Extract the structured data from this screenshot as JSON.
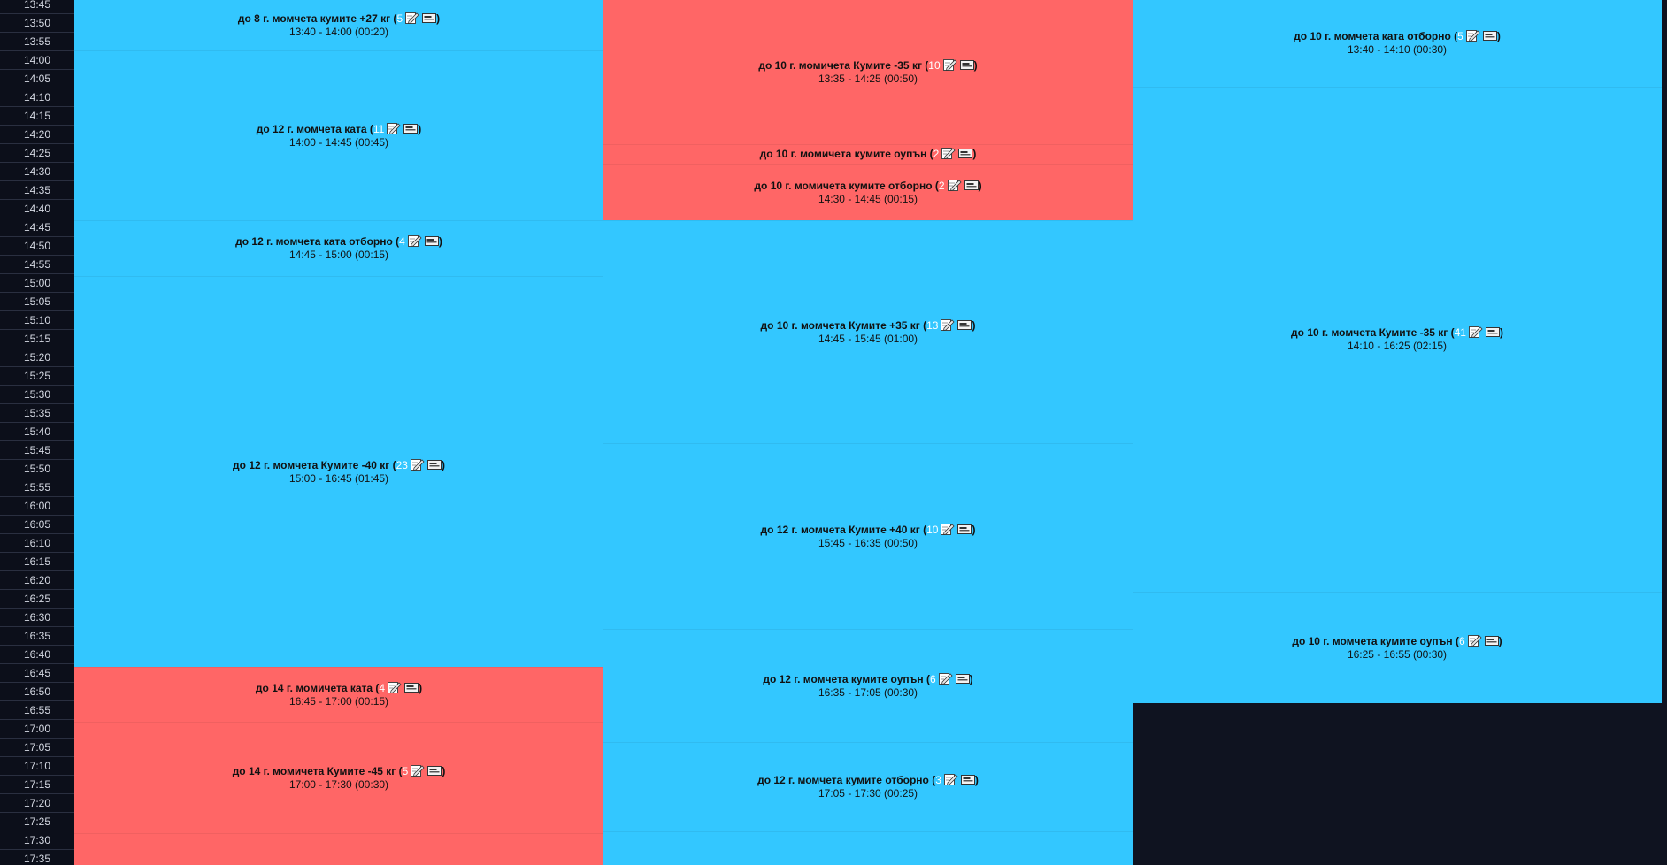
{
  "time_slots": [
    "13:45",
    "13:50",
    "13:55",
    "14:00",
    "14:05",
    "14:10",
    "14:15",
    "14:20",
    "14:25",
    "14:30",
    "14:35",
    "14:40",
    "14:45",
    "14:50",
    "14:55",
    "15:00",
    "15:05",
    "15:10",
    "15:15",
    "15:20",
    "15:25",
    "15:30",
    "15:35",
    "15:40",
    "15:45",
    "15:50",
    "15:55",
    "16:00",
    "16:05",
    "16:10",
    "16:15",
    "16:20",
    "16:25",
    "16:30",
    "16:35",
    "16:40",
    "16:45",
    "16:50",
    "16:55",
    "17:00",
    "17:05",
    "17:10",
    "17:15",
    "17:20",
    "17:25",
    "17:30",
    "17:35"
  ],
  "icons": {
    "edit": "edit-icon",
    "details": "details-icon"
  },
  "colors": {
    "blue": "#33c7ff",
    "red": "#ff6666",
    "background": "#0f1320"
  },
  "columns": [
    {
      "events": [
        {
          "title": "до 8 г. момчета кумите +27 кг (",
          "count": "5",
          "close": ")",
          "time": "13:40 - 14:00 (00:20)",
          "color": "blue"
        },
        {
          "title": "до 12 г. момчета ката (",
          "count": "11",
          "close": ")",
          "time": "14:00 - 14:45 (00:45)",
          "color": "blue"
        },
        {
          "title": "до 12 г. момчета ката отборно (",
          "count": "4",
          "close": ")",
          "time": "14:45 - 15:00 (00:15)",
          "color": "blue"
        },
        {
          "title": "до 12 г. момчета Кумите -40 кг (",
          "count": "23",
          "close": ")",
          "time": "15:00 - 16:45 (01:45)",
          "color": "blue"
        },
        {
          "title": "до 14 г. момичета ката (",
          "count": "4",
          "close": ")",
          "time": "16:45 - 17:00 (00:15)",
          "color": "red"
        },
        {
          "title": "до 14 г. момичета Кумите -45 кг (",
          "count": "5",
          "close": ")",
          "time": "17:00 - 17:30 (00:30)",
          "color": "red"
        },
        {
          "title": "",
          "count": "",
          "close": "",
          "time": "",
          "color": "red"
        }
      ]
    },
    {
      "events": [
        {
          "title": "до 10 г. момичета Кумите -35 кг (",
          "count": "10",
          "close": ")",
          "time": "13:35 - 14:25 (00:50)",
          "color": "red"
        },
        {
          "title": "до 10 г. момичета кумите оупън (",
          "count": "2",
          "close": ")",
          "time": "",
          "color": "red"
        },
        {
          "title": "до 10 г. момичета кумите отборно (",
          "count": "2",
          "close": ")",
          "time": "14:30 - 14:45 (00:15)",
          "color": "red"
        },
        {
          "title": "до 10 г. момчета Кумите +35 кг (",
          "count": "13",
          "close": ")",
          "time": "14:45 - 15:45 (01:00)",
          "color": "blue"
        },
        {
          "title": "до 12 г. момчета Кумите +40 кг (",
          "count": "10",
          "close": ")",
          "time": "15:45 - 16:35 (00:50)",
          "color": "blue"
        },
        {
          "title": "до 12 г. момчета кумите оупън (",
          "count": "6",
          "close": ")",
          "time": "16:35 - 17:05 (00:30)",
          "color": "blue"
        },
        {
          "title": "до 12 г. момчета кумите отборно (",
          "count": "3",
          "close": ")",
          "time": "17:05 - 17:30 (00:25)",
          "color": "blue"
        },
        {
          "title": "",
          "count": "",
          "close": "",
          "time": "",
          "color": "blue"
        }
      ]
    },
    {
      "events": [
        {
          "title": "до 10 г. момчета ката отборно (",
          "count": "5",
          "close": ")",
          "time": "13:40 - 14:10 (00:30)",
          "color": "blue"
        },
        {
          "title": "до 10 г. момчета Кумите -35 кг (",
          "count": "41",
          "close": ")",
          "time": "14:10 - 16:25 (02:15)",
          "color": "blue"
        },
        {
          "title": "до 10 г. момчета кумите оупън (",
          "count": "6",
          "close": ")",
          "time": "16:25 - 16:55 (00:30)",
          "color": "blue"
        }
      ]
    }
  ]
}
